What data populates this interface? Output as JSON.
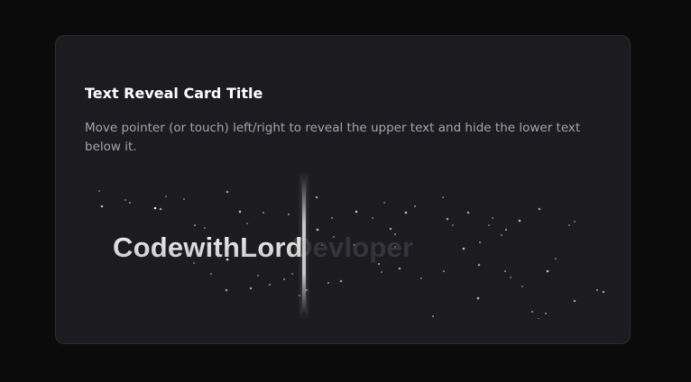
{
  "card": {
    "title": "Text Reveal Card Title",
    "description": "Move pointer (or touch) left/right to reveal the upper text and hide the lower text below it.",
    "reveal": {
      "upper_text": "CodewithLord",
      "lower_text": "Devloper",
      "reveal_fraction": 0.42
    }
  },
  "colors": {
    "page_background": "#0b0b0b",
    "card_background": "#1c1c20",
    "card_border": "#2c2c31",
    "title": "#ffffff",
    "description": "#a3a3ab",
    "upper_text": "#dcdcdc",
    "lower_text": "#34343a"
  }
}
